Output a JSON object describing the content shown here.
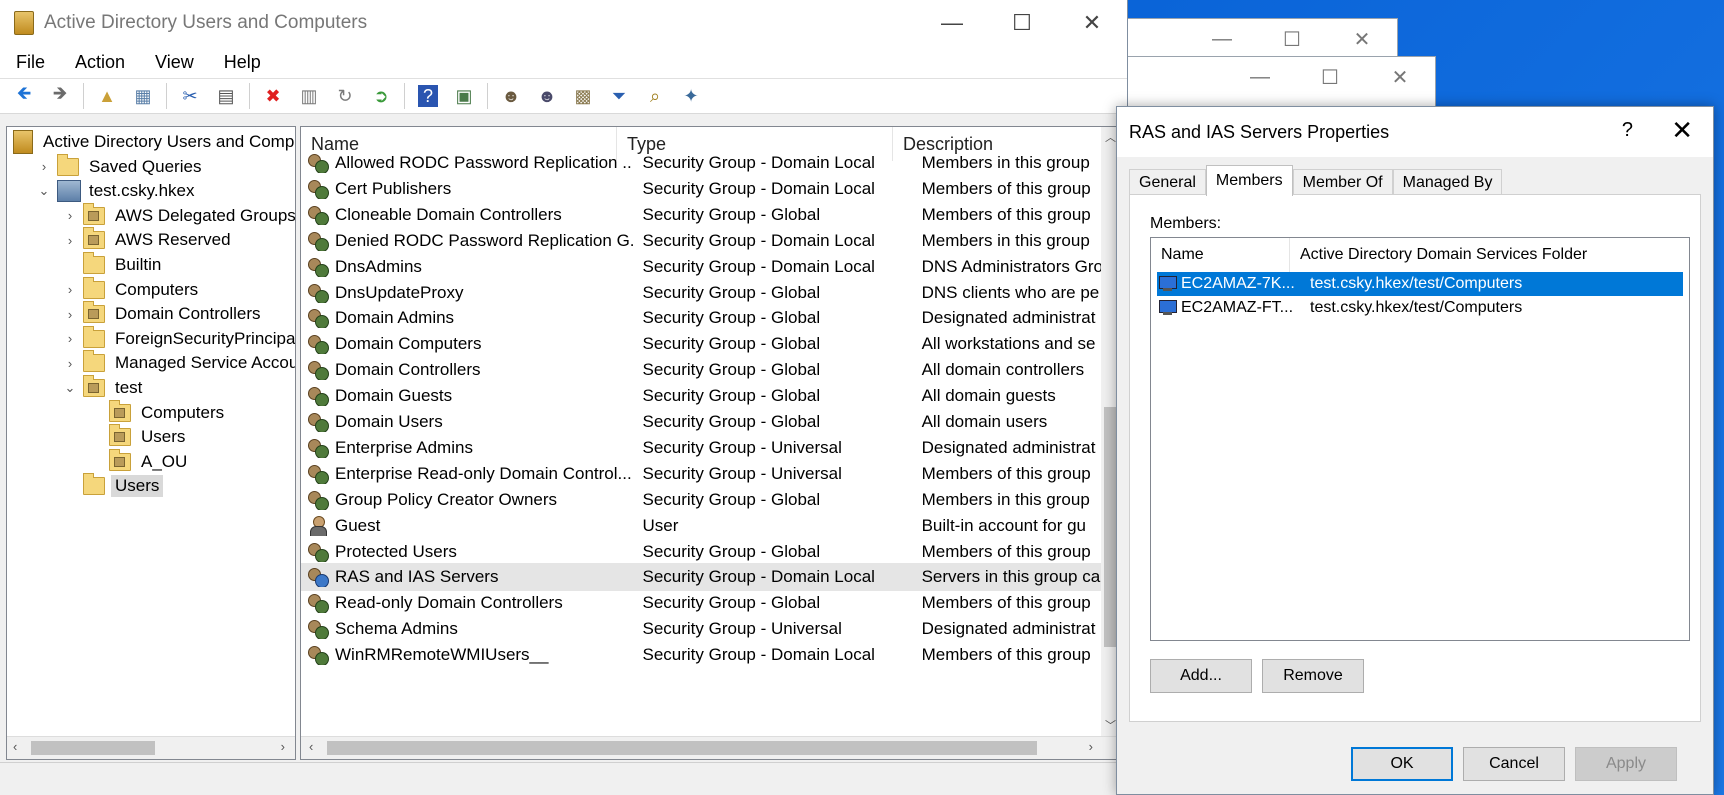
{
  "main_window": {
    "title": "Active Directory Users and Computers",
    "window_controls": {
      "minimize": "—",
      "maximize": "☐",
      "close": "✕"
    },
    "menu": [
      "File",
      "Action",
      "View",
      "Help"
    ],
    "toolbar": {
      "buttons": [
        {
          "name": "back-arrow-icon",
          "glyph": "🡸",
          "color": "#1e73d6"
        },
        {
          "name": "forward-arrow-icon",
          "glyph": "🡺",
          "color": "#6b6b6b"
        },
        {
          "name": "up-folder-icon",
          "glyph": "▲",
          "color": "#caa038"
        },
        {
          "name": "show-console-tree-icon",
          "glyph": "▦",
          "color": "#5a7fa8"
        },
        {
          "name": "cut-icon",
          "glyph": "✂",
          "color": "#2a5fb0"
        },
        {
          "name": "copy-icon",
          "glyph": "▤",
          "color": "#555555"
        },
        {
          "name": "delete-icon",
          "glyph": "✖",
          "color": "#e02020"
        },
        {
          "name": "properties-icon",
          "glyph": "▥",
          "color": "#7a7a7a"
        },
        {
          "name": "refresh-icon",
          "glyph": "↻",
          "color": "#7a7a7a"
        },
        {
          "name": "export-list-icon",
          "glyph": "➲",
          "color": "#3a9a3a"
        },
        {
          "name": "help-icon",
          "glyph": "?",
          "color": "#ffffff",
          "bg": "#2a55b0"
        },
        {
          "name": "action-pane-icon",
          "glyph": "▣",
          "color": "#4a7a4a"
        },
        {
          "name": "create-user-icon",
          "glyph": "☻",
          "color": "#6a5a40"
        },
        {
          "name": "create-group-icon",
          "glyph": "☻",
          "color": "#4a4a6a"
        },
        {
          "name": "create-ou-icon",
          "glyph": "▩",
          "color": "#8a7a50"
        },
        {
          "name": "filter-icon",
          "glyph": "⏷",
          "color": "#2a5fb0"
        },
        {
          "name": "find-icon",
          "glyph": "⌕",
          "color": "#a08020"
        },
        {
          "name": "add-to-group-icon",
          "glyph": "✦",
          "color": "#3a6a9a"
        }
      ]
    },
    "tree": [
      {
        "label": "Active Directory Users and Comp",
        "indent": 0,
        "expander": "",
        "icon": "book"
      },
      {
        "label": "Saved Queries",
        "indent": 1,
        "expander": "›",
        "icon": "folder"
      },
      {
        "label": "test.csky.hkex",
        "indent": 1,
        "expander": "⌄",
        "icon": "domain"
      },
      {
        "label": "AWS Delegated Groups",
        "indent": 2,
        "expander": "›",
        "icon": "ou"
      },
      {
        "label": "AWS Reserved",
        "indent": 2,
        "expander": "›",
        "icon": "ou"
      },
      {
        "label": "Builtin",
        "indent": 2,
        "expander": "",
        "icon": "folder"
      },
      {
        "label": "Computers",
        "indent": 2,
        "expander": "›",
        "icon": "folder"
      },
      {
        "label": "Domain Controllers",
        "indent": 2,
        "expander": "›",
        "icon": "ou"
      },
      {
        "label": "ForeignSecurityPrincipals",
        "indent": 2,
        "expander": "›",
        "icon": "folder"
      },
      {
        "label": "Managed Service Accoun",
        "indent": 2,
        "expander": "›",
        "icon": "folder"
      },
      {
        "label": "test",
        "indent": 2,
        "expander": "⌄",
        "icon": "ou"
      },
      {
        "label": "Computers",
        "indent": 3,
        "expander": "",
        "icon": "ou"
      },
      {
        "label": "Users",
        "indent": 3,
        "expander": "",
        "icon": "ou"
      },
      {
        "label": "A_OU",
        "indent": 3,
        "expander": "",
        "icon": "ou"
      },
      {
        "label": "Users",
        "indent": 2,
        "expander": "",
        "icon": "folder",
        "selected": true
      }
    ],
    "list": {
      "columns": [
        "Name",
        "Type",
        "Description"
      ],
      "rows": [
        {
          "name": "Allowed RODC Password Replication ...",
          "type": "Security Group - Domain Local",
          "desc": "Members in this group",
          "icon": "group"
        },
        {
          "name": "Cert Publishers",
          "type": "Security Group - Domain Local",
          "desc": "Members of this group",
          "icon": "group"
        },
        {
          "name": "Cloneable Domain Controllers",
          "type": "Security Group - Global",
          "desc": "Members of this group",
          "icon": "group"
        },
        {
          "name": "Denied RODC Password Replication G...",
          "type": "Security Group - Domain Local",
          "desc": "Members in this group",
          "icon": "group"
        },
        {
          "name": "DnsAdmins",
          "type": "Security Group - Domain Local",
          "desc": "DNS Administrators Gro",
          "icon": "group"
        },
        {
          "name": "DnsUpdateProxy",
          "type": "Security Group - Global",
          "desc": "DNS clients who are pe",
          "icon": "group"
        },
        {
          "name": "Domain Admins",
          "type": "Security Group - Global",
          "desc": "Designated administrat",
          "icon": "group"
        },
        {
          "name": "Domain Computers",
          "type": "Security Group - Global",
          "desc": "All workstations and se",
          "icon": "group"
        },
        {
          "name": "Domain Controllers",
          "type": "Security Group - Global",
          "desc": "All domain controllers",
          "icon": "group"
        },
        {
          "name": "Domain Guests",
          "type": "Security Group - Global",
          "desc": "All domain guests",
          "icon": "group"
        },
        {
          "name": "Domain Users",
          "type": "Security Group - Global",
          "desc": "All domain users",
          "icon": "group"
        },
        {
          "name": "Enterprise Admins",
          "type": "Security Group - Universal",
          "desc": "Designated administrat",
          "icon": "group"
        },
        {
          "name": "Enterprise Read-only Domain Control...",
          "type": "Security Group - Universal",
          "desc": "Members of this group",
          "icon": "group"
        },
        {
          "name": "Group Policy Creator Owners",
          "type": "Security Group - Global",
          "desc": "Members in this group",
          "icon": "group"
        },
        {
          "name": "Guest",
          "type": "User",
          "desc": "Built-in account for gu",
          "icon": "user"
        },
        {
          "name": "Protected Users",
          "type": "Security Group - Global",
          "desc": "Members of this group",
          "icon": "group"
        },
        {
          "name": "RAS and IAS Servers",
          "type": "Security Group - Domain Local",
          "desc": "Servers in this group ca",
          "icon": "group-blue",
          "highlighted": true
        },
        {
          "name": "Read-only Domain Controllers",
          "type": "Security Group - Global",
          "desc": "Members of this group",
          "icon": "group"
        },
        {
          "name": "Schema Admins",
          "type": "Security Group - Universal",
          "desc": "Designated administrat",
          "icon": "group"
        },
        {
          "name": "WinRMRemoteWMIUsers__",
          "type": "Security Group - Domain Local",
          "desc": "Members of this group",
          "icon": "group"
        }
      ]
    }
  },
  "dialog": {
    "title": "RAS and IAS Servers Properties",
    "help": "?",
    "close": "✕",
    "tabs": [
      "General",
      "Members",
      "Member Of",
      "Managed By"
    ],
    "active_tab": "Members",
    "members_label": "Members:",
    "columns": [
      "Name",
      "Active Directory Domain Services Folder"
    ],
    "members": [
      {
        "name": "EC2AMAZ-7K...",
        "folder": "test.csky.hkex/test/Computers",
        "selected": true
      },
      {
        "name": "EC2AMAZ-FT...",
        "folder": "test.csky.hkex/test/Computers",
        "selected": false
      }
    ],
    "buttons": {
      "add": "Add...",
      "remove": "Remove",
      "ok": "OK",
      "cancel": "Cancel",
      "apply": "Apply"
    }
  },
  "background_windows": {
    "minimize": "—",
    "maximize": "☐",
    "close": "✕"
  }
}
